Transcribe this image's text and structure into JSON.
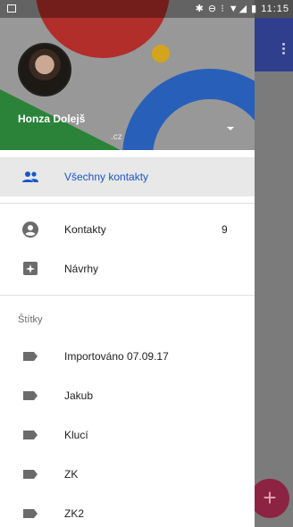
{
  "status_bar": {
    "time": "11:15",
    "icons": "✱ ⊖ ⁝ ▼◢ ▮"
  },
  "account": {
    "name": "Honza Dolejš",
    "domain": ".cz"
  },
  "nav": {
    "all_contacts": "Všechny kontakty",
    "contacts": "Kontakty",
    "contacts_count": "9",
    "suggestions": "Návrhy"
  },
  "labels": {
    "section_title": "Štítky",
    "items": [
      "Importováno 07.09.17",
      "Jakub",
      "Klucí",
      "ZK",
      "ZK2"
    ]
  },
  "fab": {
    "symbol": "+"
  },
  "colors": {
    "accent": "#1a56c4",
    "toolbar": "#2f3f8e",
    "fab": "#8c2342"
  }
}
